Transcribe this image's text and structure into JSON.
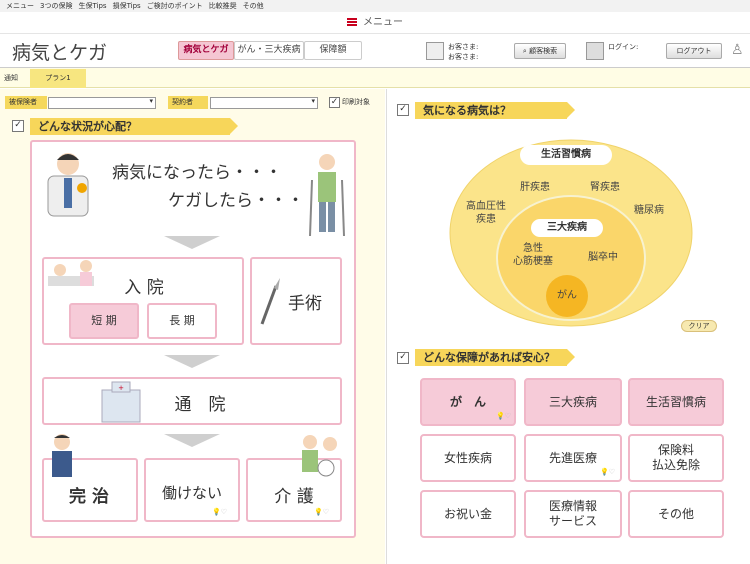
{
  "top_menu": [
    "メニュー",
    "3つの保険",
    "生保Tips",
    "損保Tips",
    "ご検討のポイント",
    "比較推奨",
    "その他"
  ],
  "menu_bar_label": "メニュー",
  "header": {
    "title": "病気とケガ",
    "tabs": [
      "病気とケガ",
      "がん・三大疾病",
      "保障額"
    ],
    "customer_label_1": "お客さま:",
    "customer_label_2": "お客さま:",
    "customer_search": "顧客検索",
    "login_label": "ログイン:",
    "logout": "ログアウト"
  },
  "subtabs": [
    "通知",
    "プラン1"
  ],
  "filters": {
    "insured_label": "被保険者",
    "contractor_label": "契約者",
    "print_label": "印刷対象"
  },
  "left": {
    "section_title": "どんな状況が心配？",
    "intro_line1": "病気になったら・・・",
    "intro_line2": "ケガしたら・・・",
    "hospital": "入 院",
    "short_term": "短 期",
    "long_term": "長 期",
    "surgery": "手術",
    "outpatient": "通　院",
    "recovery": "完 治",
    "cannot_work": "働けない",
    "care": "介 護"
  },
  "right": {
    "worry_title": "気になる病気は？",
    "lifestyle_label": "生活習慣病",
    "liver": "肝疾患",
    "kidney": "腎疾患",
    "hypertension": "高血圧性\n疾患",
    "diabetes": "糖尿病",
    "three_major_label": "三大疾病",
    "heart": "急性\n心筋梗塞",
    "stroke": "脳卒中",
    "cancer": "がん",
    "clear": "クリア",
    "coverage_title": "どんな保障があれば安心？",
    "coverage": [
      "が　ん",
      "三大疾病",
      "生活習慣病",
      "女性疾病",
      "先進医療",
      "保険料\n払込免除",
      "お祝い金",
      "医療情報\nサービス",
      "その他"
    ]
  },
  "colors": {
    "accent_red": "#c8001e",
    "pink": "#f6cbd8",
    "yellow": "#f7d65a",
    "circle_outer": "#fbe48a",
    "circle_inner": "#fad66a",
    "cancer": "#f5b623"
  }
}
